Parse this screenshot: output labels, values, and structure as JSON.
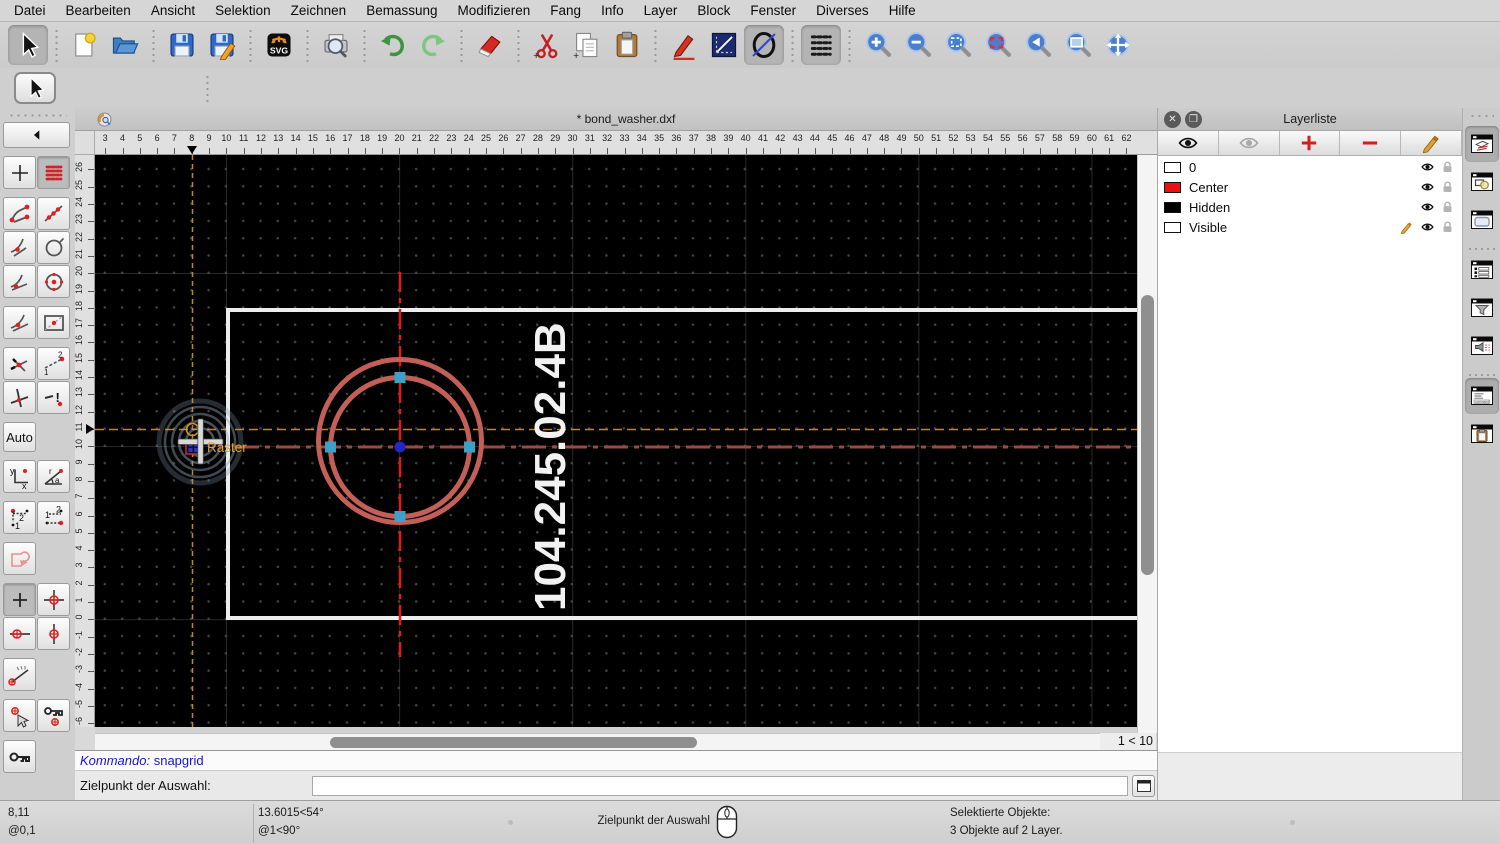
{
  "menu": {
    "items": [
      "Datei",
      "Bearbeiten",
      "Ansicht",
      "Selektion",
      "Zeichnen",
      "Bemassung",
      "Modifizieren",
      "Fang",
      "Info",
      "Layer",
      "Block",
      "Fenster",
      "Diverses",
      "Hilfe"
    ]
  },
  "window": {
    "title": "* bond_washer.dxf"
  },
  "toolbar": {
    "groups": [
      [
        {
          "icon": "cursor",
          "selected": true
        }
      ],
      [
        {
          "icon": "file-new"
        },
        {
          "icon": "folder-open"
        }
      ],
      [
        {
          "icon": "save"
        },
        {
          "icon": "save-as"
        }
      ],
      [
        {
          "icon": "svg-export"
        }
      ],
      [
        {
          "icon": "print-preview"
        }
      ],
      [
        {
          "icon": "undo"
        },
        {
          "icon": "redo"
        }
      ],
      [
        {
          "icon": "eraser"
        }
      ],
      [
        {
          "icon": "cut"
        },
        {
          "icon": "copy"
        },
        {
          "icon": "paste"
        }
      ],
      [
        {
          "icon": "draw-pencil"
        },
        {
          "icon": "line-tool"
        },
        {
          "icon": "ellipse-tool",
          "selected": true
        }
      ],
      [
        {
          "icon": "grid-toggle",
          "selected": true
        }
      ],
      [
        {
          "icon": "zoom-in"
        },
        {
          "icon": "zoom-out"
        },
        {
          "icon": "zoom-auto"
        },
        {
          "icon": "zoom-selection"
        },
        {
          "icon": "zoom-previous"
        },
        {
          "icon": "zoom-window"
        },
        {
          "icon": "zoom-pan"
        }
      ]
    ]
  },
  "palette": {
    "rows": [
      {
        "icons": [
          {
            "icon": "back-arrow",
            "wide": true
          }
        ]
      },
      {
        "icons": [
          {
            "icon": "snap-free"
          },
          {
            "icon": "snap-grid",
            "selected": true
          }
        ],
        "gap": true
      },
      {
        "icons": [
          {
            "icon": "snap-endpoints"
          },
          {
            "icon": "snap-on-entity"
          }
        ],
        "gap": true
      },
      {
        "icons": [
          {
            "icon": "snap-perpendicular"
          },
          {
            "icon": "snap-circle"
          }
        ]
      },
      {
        "icons": [
          {
            "icon": "snap-tangent"
          },
          {
            "icon": "snap-center"
          }
        ]
      },
      {
        "icons": [
          {
            "icon": "snap-middle"
          },
          {
            "icon": "snap-reference"
          }
        ],
        "gap": true
      },
      {
        "icons": [
          {
            "icon": "snap-intersection"
          },
          {
            "icon": "snap-distance"
          }
        ],
        "gap": true
      },
      {
        "icons": [
          {
            "icon": "snap-ortho"
          },
          {
            "icon": "snap-restrict-off"
          }
        ]
      },
      {
        "label": "Auto",
        "gap": true
      },
      {
        "icons": [
          {
            "icon": "coord-cartesian"
          },
          {
            "icon": "coord-polar"
          }
        ],
        "gap": true
      },
      {
        "icons": [
          {
            "icon": "dim-relative"
          },
          {
            "icon": "dim-absolute"
          }
        ],
        "gap": true
      },
      {
        "icons": [
          {
            "icon": "shape-tool"
          }
        ],
        "gap": true
      },
      {
        "icons": [
          {
            "icon": "plus-tool",
            "selected": true
          },
          {
            "icon": "crosshair-full"
          }
        ],
        "gap": true
      },
      {
        "icons": [
          {
            "icon": "crosshair-horizontal"
          },
          {
            "icon": "crosshair-vertical"
          }
        ]
      },
      {
        "icons": [
          {
            "icon": "protractor"
          }
        ],
        "gap": true
      },
      {
        "icons": [
          {
            "icon": "snap-select-point"
          },
          {
            "icon": "lock-relative-zero"
          }
        ],
        "gap": true
      },
      {
        "icons": [
          {
            "icon": "relative-zero-key"
          }
        ],
        "gap": true
      }
    ]
  },
  "rulers": {
    "h": {
      "min": 3,
      "max": 62,
      "marker": 8
    },
    "v": {
      "min": -6,
      "max": 27,
      "marker": 11
    }
  },
  "grid_label": "1 < 10",
  "drawing": {
    "part_label": "104.245.02.4B",
    "snap_tooltip": "Raster",
    "colors": {
      "selected_entity": "#c45f58",
      "centerline": "#e31b17",
      "selected_centerline": "#9a4a40",
      "crosshair": "#c8851c",
      "handle": "#3aa2c8",
      "reference_point": "#2326c8",
      "outline": "#ededed"
    }
  },
  "command": {
    "history_label": "Kommando:",
    "history_value": "snapgrid",
    "prompt_label": "Zielpunkt der Auswahl:",
    "input_value": ""
  },
  "layers": {
    "title": "Layerliste",
    "toolbar": [
      {
        "icon": "eye-all"
      },
      {
        "icon": "eye-none"
      },
      {
        "icon": "layer-add"
      },
      {
        "icon": "layer-remove"
      },
      {
        "icon": "layer-edit"
      }
    ],
    "items": [
      {
        "name": "0",
        "color": "#ffffff",
        "current": false
      },
      {
        "name": "Center",
        "color": "#e81010",
        "current": false
      },
      {
        "name": "Hidden",
        "color": "#000000",
        "current": false
      },
      {
        "name": "Visible",
        "color": "#ffffff",
        "current": true
      }
    ]
  },
  "dock": {
    "items": [
      {
        "icon": "dock-layer",
        "selected": true
      },
      {
        "icon": "dock-block"
      },
      {
        "icon": "dock-view"
      },
      {
        "gap": true
      },
      {
        "icon": "dock-property"
      },
      {
        "icon": "dock-filter"
      },
      {
        "icon": "dock-library"
      },
      {
        "gap": true
      },
      {
        "icon": "dock-command",
        "selected": true
      },
      {
        "icon": "dock-clipboard"
      }
    ]
  },
  "status": {
    "coord_abs": "8,11",
    "coord_rel": "@0,1",
    "polar_abs": "13.6015<54°",
    "polar_rel": "@1<90°",
    "hint": "Zielpunkt der Auswahl",
    "selected_title": "Selektierte Objekte:",
    "selected_detail": "3 Objekte auf 2 Layer."
  }
}
